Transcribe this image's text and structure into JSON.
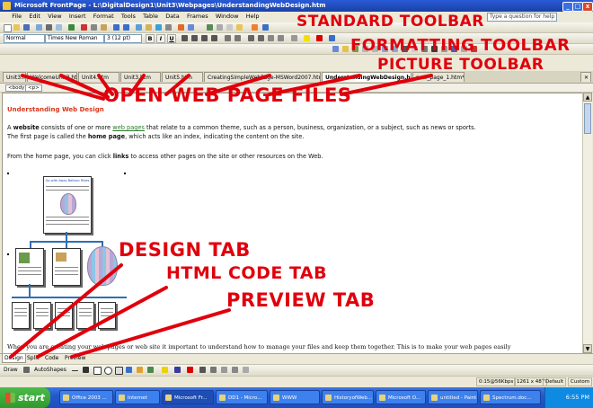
{
  "window": {
    "title": "Microsoft FrontPage - L:\\DigitalDesign1\\Unit3\\Webpages\\UnderstandingWebDesign.htm",
    "minimize": "_",
    "maximize": "□",
    "close": "x"
  },
  "menubar": {
    "items": [
      "File",
      "Edit",
      "View",
      "Insert",
      "Format",
      "Tools",
      "Table",
      "Data",
      "Frames",
      "Window",
      "Help"
    ],
    "help_placeholder": "Type a question for help"
  },
  "formatting": {
    "style": "Normal",
    "font": "Times New Roman",
    "size": "3 (12 pt)",
    "bold": "B",
    "italic": "I",
    "underline": "U"
  },
  "doc_tabs": [
    "Unit3.htm",
    "WelcomeUnit3.htm",
    "Unit4.htm",
    "Unit3.htm",
    "Unit5.htm",
    "CreatingSimpleWebPage-MSWord2007.htm",
    "UnderstandingWebDesign.htm",
    "new_page_1.htm*"
  ],
  "active_tab_index": 6,
  "tag_selector": [
    "<body>",
    "<p>"
  ],
  "page": {
    "heading": "Understanding Web Design",
    "p1_a": "A ",
    "p1_bold": "website",
    "p1_b": " consists of one or more ",
    "p1_link": "web pages",
    "p1_c": " that relate to a common theme, such as a person, business, organization, or a subject, such as news or sports.",
    "p2_a": "The first page is called the ",
    "p2_bold": "home page",
    "p2_b": ", which acts like an index, indicating the content on the site.",
    "p3_a": "From the home page, you can click ",
    "p3_bold": "links",
    "p3_b": " to access other pages on the site or other resources on the Web.",
    "bottom_text": "When you are creating your web pages or web site it important to understand how to manage your files and keep them together. This is to make your web pages easily",
    "thumb_title": "Go-with Away Balloon Rides"
  },
  "view_tabs": [
    "Design",
    "Split",
    "Code",
    "Preview"
  ],
  "drawing_toolbar": {
    "draw": "Draw",
    "autoshapes": "AutoShapes"
  },
  "status": {
    "speed": "0:15@56Kbps",
    "size": "1261 x 487",
    "mode": "Default",
    "custom": "Custom"
  },
  "taskbar": {
    "start": "start",
    "buttons": [
      "Office 2003 ...",
      "Internet",
      "Microsoft Fr...",
      "DD1 - Micro...",
      "WWW",
      "HistoryofWeb...",
      "Microsoft O...",
      "untitled - Paint",
      "Spectrum.doc..."
    ],
    "active_index": 2,
    "clock": "6:55 PM"
  },
  "annotations": {
    "standard_toolbar": "STANDARD TOOLBAR",
    "formatting_toolbar": "FORMATTING TOOLBAR",
    "picture_toolbar": "PICTURE TOOLBAR",
    "open_files": "OPEN WEB PAGE FILES",
    "design_tab": "DESIGN TAB",
    "html_code_tab": "HTML CODE TAB",
    "preview_tab": "PREVIEW TAB"
  },
  "colors": {
    "annotation": "#e0000c",
    "heading": "#d8371b",
    "link": "#2a7a2a",
    "titlebar": "#1941a5"
  }
}
